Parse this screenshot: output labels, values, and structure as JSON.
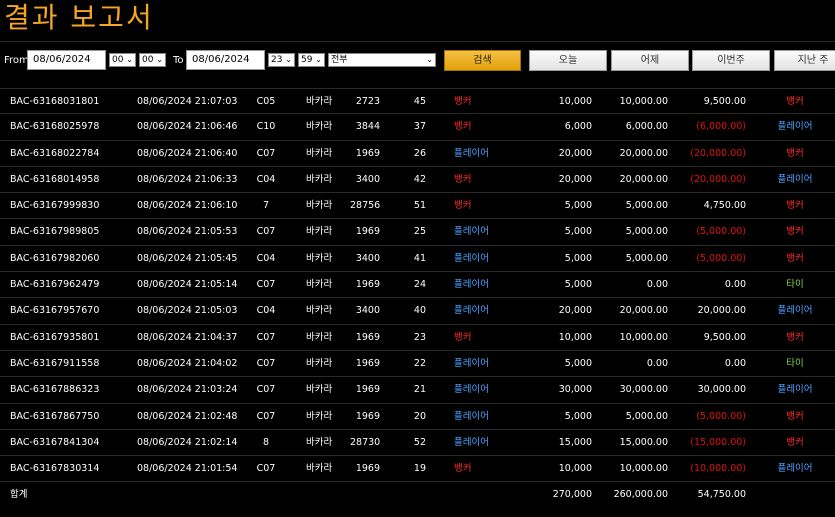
{
  "page": {
    "title": "결과 보고서"
  },
  "filter": {
    "from_label": "From",
    "from_date": "08/06/2024",
    "from_hour": "00",
    "from_min": "00",
    "to_label": "To",
    "to_date": "08/06/2024",
    "to_hour": "23",
    "to_min": "59",
    "category": "전부",
    "search_label": "검색",
    "quick": [
      "오늘",
      "어제",
      "이번주",
      "지난 주"
    ]
  },
  "rows": [
    {
      "id": "BAC-63168031801",
      "datetime": "08/06/2024 21:07:03",
      "table": "C05",
      "game": "바카라",
      "round": "2723",
      "shoe": "45",
      "bet": "뱅커",
      "bet_type": "banker",
      "amount": "10,000",
      "valid": "10,000.00",
      "winloss": "9,500.00",
      "wl_neg": false,
      "result": "뱅커",
      "result_type": "banker"
    },
    {
      "id": "BAC-63168025978",
      "datetime": "08/06/2024 21:06:46",
      "table": "C10",
      "game": "바카라",
      "round": "3844",
      "shoe": "37",
      "bet": "뱅커",
      "bet_type": "banker",
      "amount": "6,000",
      "valid": "6,000.00",
      "winloss": "(6,000.00)",
      "wl_neg": true,
      "result": "플레이어",
      "result_type": "player"
    },
    {
      "id": "BAC-63168022784",
      "datetime": "08/06/2024 21:06:40",
      "table": "C07",
      "game": "바카라",
      "round": "1969",
      "shoe": "26",
      "bet": "플레이어",
      "bet_type": "player",
      "amount": "20,000",
      "valid": "20,000.00",
      "winloss": "(20,000.00)",
      "wl_neg": true,
      "result": "뱅커",
      "result_type": "banker"
    },
    {
      "id": "BAC-63168014958",
      "datetime": "08/06/2024 21:06:33",
      "table": "C04",
      "game": "바카라",
      "round": "3400",
      "shoe": "42",
      "bet": "뱅커",
      "bet_type": "banker",
      "amount": "20,000",
      "valid": "20,000.00",
      "winloss": "(20,000.00)",
      "wl_neg": true,
      "result": "플레이어",
      "result_type": "player"
    },
    {
      "id": "BAC-63167999830",
      "datetime": "08/06/2024 21:06:10",
      "table": "7",
      "game": "바카라",
      "round": "28756",
      "shoe": "51",
      "bet": "뱅커",
      "bet_type": "banker",
      "amount": "5,000",
      "valid": "5,000.00",
      "winloss": "4,750.00",
      "wl_neg": false,
      "result": "뱅커",
      "result_type": "banker"
    },
    {
      "id": "BAC-63167989805",
      "datetime": "08/06/2024 21:05:53",
      "table": "C07",
      "game": "바카라",
      "round": "1969",
      "shoe": "25",
      "bet": "플레이어",
      "bet_type": "player",
      "amount": "5,000",
      "valid": "5,000.00",
      "winloss": "(5,000.00)",
      "wl_neg": true,
      "result": "뱅커",
      "result_type": "banker"
    },
    {
      "id": "BAC-63167982060",
      "datetime": "08/06/2024 21:05:45",
      "table": "C04",
      "game": "바카라",
      "round": "3400",
      "shoe": "41",
      "bet": "플레이어",
      "bet_type": "player",
      "amount": "5,000",
      "valid": "5,000.00",
      "winloss": "(5,000.00)",
      "wl_neg": true,
      "result": "뱅커",
      "result_type": "banker"
    },
    {
      "id": "BAC-63167962479",
      "datetime": "08/06/2024 21:05:14",
      "table": "C07",
      "game": "바카라",
      "round": "1969",
      "shoe": "24",
      "bet": "플레이어",
      "bet_type": "player",
      "amount": "5,000",
      "valid": "0.00",
      "winloss": "0.00",
      "wl_neg": false,
      "result": "타이",
      "result_type": "tie"
    },
    {
      "id": "BAC-63167957670",
      "datetime": "08/06/2024 21:05:03",
      "table": "C04",
      "game": "바카라",
      "round": "3400",
      "shoe": "40",
      "bet": "플레이어",
      "bet_type": "player",
      "amount": "20,000",
      "valid": "20,000.00",
      "winloss": "20,000.00",
      "wl_neg": false,
      "result": "플레이어",
      "result_type": "player"
    },
    {
      "id": "BAC-63167935801",
      "datetime": "08/06/2024 21:04:37",
      "table": "C07",
      "game": "바카라",
      "round": "1969",
      "shoe": "23",
      "bet": "뱅커",
      "bet_type": "banker",
      "amount": "10,000",
      "valid": "10,000.00",
      "winloss": "9,500.00",
      "wl_neg": false,
      "result": "뱅커",
      "result_type": "banker"
    },
    {
      "id": "BAC-63167911558",
      "datetime": "08/06/2024 21:04:02",
      "table": "C07",
      "game": "바카라",
      "round": "1969",
      "shoe": "22",
      "bet": "플레이어",
      "bet_type": "player",
      "amount": "5,000",
      "valid": "0.00",
      "winloss": "0.00",
      "wl_neg": false,
      "result": "타이",
      "result_type": "tie"
    },
    {
      "id": "BAC-63167886323",
      "datetime": "08/06/2024 21:03:24",
      "table": "C07",
      "game": "바카라",
      "round": "1969",
      "shoe": "21",
      "bet": "플레이어",
      "bet_type": "player",
      "amount": "30,000",
      "valid": "30,000.00",
      "winloss": "30,000.00",
      "wl_neg": false,
      "result": "플레이어",
      "result_type": "player"
    },
    {
      "id": "BAC-63167867750",
      "datetime": "08/06/2024 21:02:48",
      "table": "C07",
      "game": "바카라",
      "round": "1969",
      "shoe": "20",
      "bet": "플레이어",
      "bet_type": "player",
      "amount": "5,000",
      "valid": "5,000.00",
      "winloss": "(5,000.00)",
      "wl_neg": true,
      "result": "뱅커",
      "result_type": "banker"
    },
    {
      "id": "BAC-63167841304",
      "datetime": "08/06/2024 21:02:14",
      "table": "8",
      "game": "바카라",
      "round": "28730",
      "shoe": "52",
      "bet": "플레이어",
      "bet_type": "player",
      "amount": "15,000",
      "valid": "15,000.00",
      "winloss": "(15,000.00)",
      "wl_neg": true,
      "result": "뱅커",
      "result_type": "banker"
    },
    {
      "id": "BAC-63167830314",
      "datetime": "08/06/2024 21:01:54",
      "table": "C07",
      "game": "바카라",
      "round": "1969",
      "shoe": "19",
      "bet": "뱅커",
      "bet_type": "banker",
      "amount": "10,000",
      "valid": "10,000.00",
      "winloss": "(10,000.00)",
      "wl_neg": true,
      "result": "플레이어",
      "result_type": "player"
    }
  ],
  "totals": {
    "label": "합계",
    "amount": "270,000",
    "valid": "260,000.00",
    "winloss": "54,750.00"
  },
  "colors": {
    "title": "#f5a623",
    "banker": "#ff2a2a",
    "player": "#4aa3ff",
    "tie": "#7fd84a",
    "negative": "#e01010",
    "search_button": "#f0b429"
  }
}
